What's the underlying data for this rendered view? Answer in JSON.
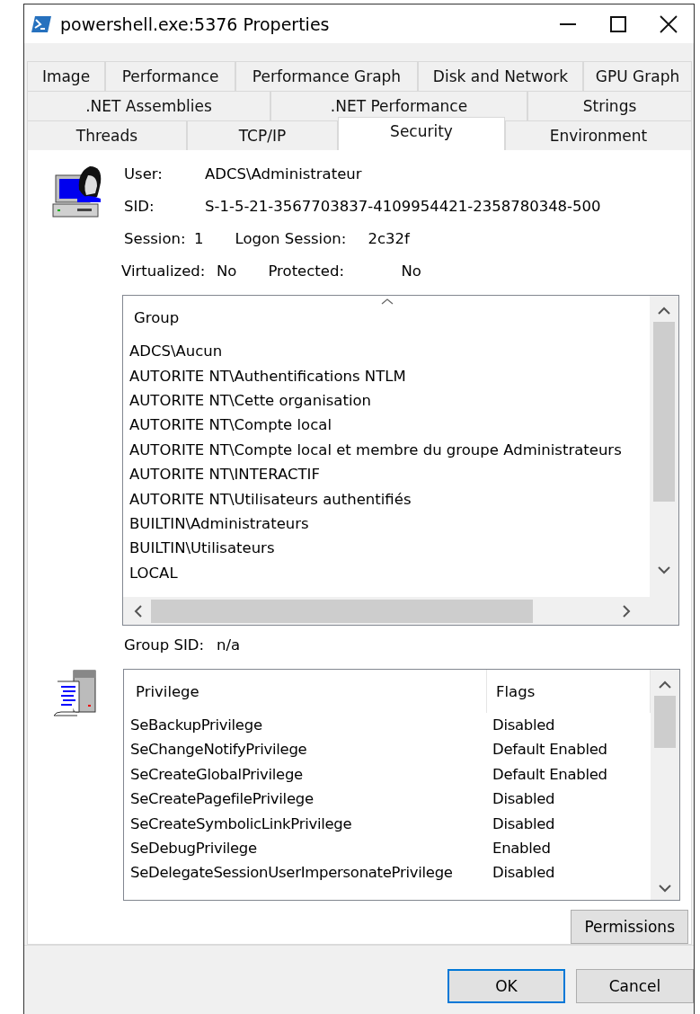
{
  "window": {
    "title": "powershell.exe:5376 Properties"
  },
  "tab_rows": [
    [
      {
        "label": "Image",
        "selected": false
      },
      {
        "label": "Performance",
        "selected": false
      },
      {
        "label": "Performance Graph",
        "selected": false
      },
      {
        "label": "Disk and Network",
        "selected": false
      },
      {
        "label": "GPU Graph",
        "selected": false
      }
    ],
    [
      {
        "label": ".NET Assemblies",
        "selected": false
      },
      {
        "label": ".NET Performance",
        "selected": false
      },
      {
        "label": "Strings",
        "selected": false
      }
    ],
    [
      {
        "label": "Threads",
        "selected": false
      },
      {
        "label": "TCP/IP",
        "selected": false
      },
      {
        "label": "Security",
        "selected": true
      },
      {
        "label": "Environment",
        "selected": false
      }
    ]
  ],
  "info": {
    "user_label": "User:",
    "user": "ADCS\\Administrateur",
    "sid_label": "SID:",
    "sid": "S-1-5-21-3567703837-4109954421-2358780348-500",
    "session_label": "Session:",
    "session": "1",
    "logon_session_label": "Logon Session:",
    "logon_session": "2c32f",
    "virtualized_label": "Virtualized:",
    "virtualized": "No",
    "protected_label": "Protected:",
    "protected": "No"
  },
  "groups": {
    "columns": [
      "Group"
    ],
    "rows": [
      "ADCS\\Aucun",
      "AUTORITE NT\\Authentifications NTLM",
      "AUTORITE NT\\Cette organisation",
      "AUTORITE NT\\Compte local",
      "AUTORITE NT\\Compte local et membre du groupe Administrateurs",
      "AUTORITE NT\\INTERACTIF",
      "AUTORITE NT\\Utilisateurs authentifiés",
      "BUILTIN\\Administrateurs",
      "BUILTIN\\Utilisateurs",
      "LOCAL"
    ]
  },
  "group_sid": {
    "label": "Group SID:",
    "value": "n/a"
  },
  "privileges": {
    "columns": [
      "Privilege",
      "Flags"
    ],
    "rows": [
      [
        "SeBackupPrivilege",
        "Disabled"
      ],
      [
        "SeChangeNotifyPrivilege",
        "Default Enabled"
      ],
      [
        "SeCreateGlobalPrivilege",
        "Default Enabled"
      ],
      [
        "SeCreatePagefilePrivilege",
        "Disabled"
      ],
      [
        "SeCreateSymbolicLinkPrivilege",
        "Disabled"
      ],
      [
        "SeDebugPrivilege",
        "Enabled"
      ],
      [
        "SeDelegateSessionUserImpersonatePrivilege",
        "Disabled"
      ]
    ]
  },
  "permissions_button": "Permissions",
  "buttons": [
    {
      "label": "OK",
      "default": true
    },
    {
      "label": "Cancel",
      "default": false
    }
  ]
}
